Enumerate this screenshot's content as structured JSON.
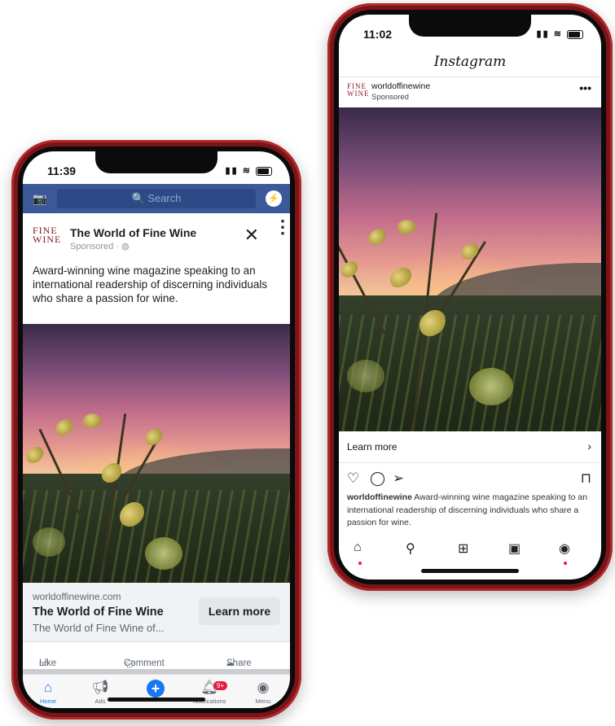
{
  "facebook": {
    "status_time": "11:39",
    "search_placeholder": "Search",
    "brand_logo": "FINE WINE",
    "page_name": "The World of Fine Wine",
    "sponsored": "Sponsored · ",
    "post_text": "Award-winning wine magazine speaking to an international readership of discerning individuals who share a passion for wine.",
    "link_domain": "worldoffinewine.com",
    "link_title": "The World of Fine Wine",
    "link_desc": "The World of Fine Wine of...",
    "learn_more": "Learn more",
    "actions": {
      "like": "Like",
      "comment": "Comment",
      "share": "Share"
    },
    "nav": [
      {
        "label": "Home",
        "icon": "home-icon"
      },
      {
        "label": "Ads",
        "icon": "megaphone-icon"
      },
      {
        "label": "",
        "icon": "plus-icon"
      },
      {
        "label": "Notifications",
        "icon": "bell-icon",
        "badge": "9+"
      },
      {
        "label": "Menu",
        "icon": "profile-icon"
      }
    ],
    "accent": "#3b5998"
  },
  "instagram": {
    "status_time": "11:02",
    "app_title": "Instagram",
    "brand_logo": "FINE WINE",
    "username": "worldoffinewine",
    "sponsored": "Sponsored",
    "learn_more": "Learn more",
    "caption_user": "worldoffinewine",
    "caption_text": " Award-winning wine magazine speaking to an international readership of discerning individuals who share a passion for wine."
  }
}
